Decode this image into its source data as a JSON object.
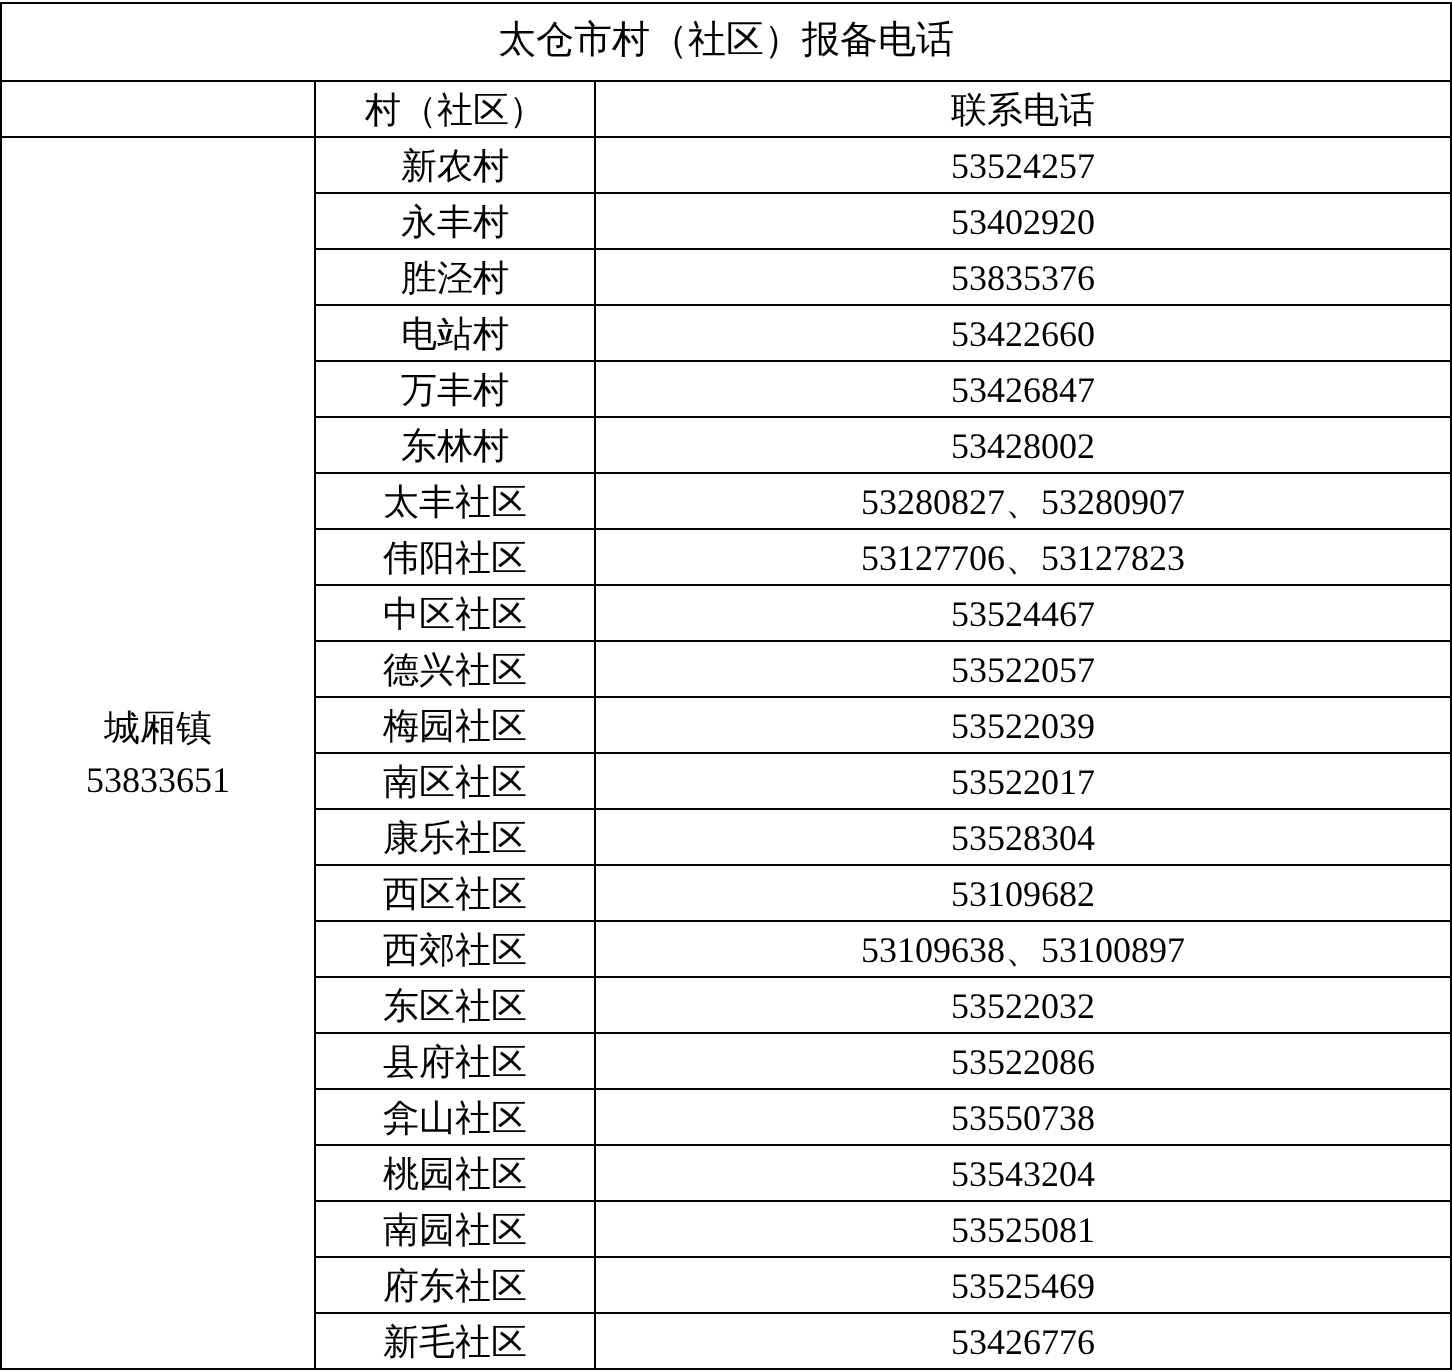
{
  "title": "太仓市村（社区）报备电话",
  "columns": [
    "村（社区）",
    "联系电话"
  ],
  "town": {
    "name": "城厢镇",
    "phone": "53833651"
  },
  "rows": [
    {
      "name": "新农村",
      "phone": "53524257"
    },
    {
      "name": "永丰村",
      "phone": "53402920"
    },
    {
      "name": "胜泾村",
      "phone": "53835376"
    },
    {
      "name": "电站村",
      "phone": "53422660"
    },
    {
      "name": "万丰村",
      "phone": "53426847"
    },
    {
      "name": "东林村",
      "phone": "53428002"
    },
    {
      "name": "太丰社区",
      "phone": "53280827、53280907"
    },
    {
      "name": "伟阳社区",
      "phone": "53127706、53127823"
    },
    {
      "name": "中区社区",
      "phone": "53524467"
    },
    {
      "name": "德兴社区",
      "phone": "53522057"
    },
    {
      "name": "梅园社区",
      "phone": "53522039"
    },
    {
      "name": "南区社区",
      "phone": "53522017"
    },
    {
      "name": "康乐社区",
      "phone": "53528304"
    },
    {
      "name": "西区社区",
      "phone": "53109682"
    },
    {
      "name": "西郊社区",
      "phone": "53109638、53100897"
    },
    {
      "name": "东区社区",
      "phone": "53522032"
    },
    {
      "name": "县府社区",
      "phone": "53522086"
    },
    {
      "name": "弇山社区",
      "phone": "53550738"
    },
    {
      "name": "桃园社区",
      "phone": "53543204"
    },
    {
      "name": "南园社区",
      "phone": "53525081"
    },
    {
      "name": "府东社区",
      "phone": "53525469"
    },
    {
      "name": "新毛社区",
      "phone": "53426776"
    }
  ]
}
